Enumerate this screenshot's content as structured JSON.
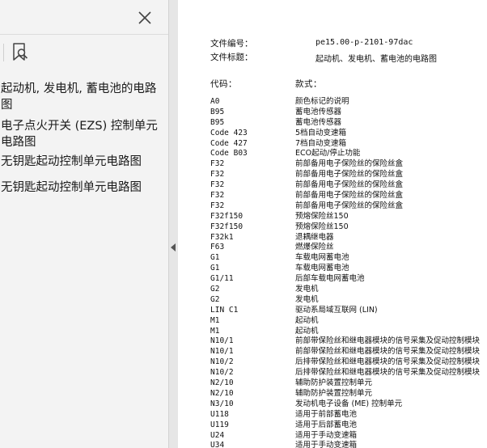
{
  "sidebar": {
    "items": [
      {
        "label": "起动机, 发电机, 蓄电池的电路图"
      },
      {
        "label": "电子点火开关 (EZS) 控制单元电路图"
      },
      {
        "label": "无钥匙起动控制单元电路图"
      },
      {
        "label": "无钥匙起动控制单元电路图"
      }
    ]
  },
  "document": {
    "file_number_label": "文件编号：",
    "file_number_value": "pe15.00-p-2101-97dac",
    "file_title_label": "文件标题：",
    "file_title_value": "起动机、发电机、蓄电池的电路图",
    "code_header": "代码：",
    "desc_header": "款式：",
    "rows": [
      {
        "code": "A0",
        "desc": "颜色标记的说明"
      },
      {
        "code": "B95",
        "desc": "蓄电池传感器"
      },
      {
        "code": "B95",
        "desc": "蓄电池传感器"
      },
      {
        "code": "Code 423",
        "desc": "5档自动变速箱"
      },
      {
        "code": "Code 427",
        "desc": "7档自动变速箱"
      },
      {
        "code": "Code B03",
        "desc": "ECO起动/停止功能"
      },
      {
        "code": "F32",
        "desc": "前部备用电子保险丝的保险丝盒"
      },
      {
        "code": "F32",
        "desc": "前部备用电子保险丝的保险丝盒"
      },
      {
        "code": "F32",
        "desc": "前部备用电子保险丝的保险丝盒"
      },
      {
        "code": "F32",
        "desc": "前部备用电子保险丝的保险丝盒"
      },
      {
        "code": "F32",
        "desc": "前部备用电子保险丝的保险丝盒"
      },
      {
        "code": "F32f150",
        "desc": "预熔保险丝150"
      },
      {
        "code": "F32f150",
        "desc": "预熔保险丝150"
      },
      {
        "code": "F32k1",
        "desc": "退耦继电器"
      },
      {
        "code": "F63",
        "desc": "燃爆保险丝"
      },
      {
        "code": "G1",
        "desc": "车载电网蓄电池"
      },
      {
        "code": "G1",
        "desc": "车载电网蓄电池"
      },
      {
        "code": "G1/11",
        "desc": "后部车载电网蓄电池"
      },
      {
        "code": "G2",
        "desc": "发电机"
      },
      {
        "code": "G2",
        "desc": "发电机"
      },
      {
        "code": "LIN C1",
        "desc": "驱动系局域互联网 (LIN)"
      },
      {
        "code": "M1",
        "desc": "起动机"
      },
      {
        "code": "M1",
        "desc": "起动机"
      },
      {
        "code": "N10/1",
        "desc": "前部带保险丝和继电器模块的信号采集及促动控制模块"
      },
      {
        "code": "N10/1",
        "desc": "前部带保险丝和继电器模块的信号采集及促动控制模块"
      },
      {
        "code": "N10/2",
        "desc": "后排带保险丝和继电器模块的信号采集及促动控制模块"
      },
      {
        "code": "N10/2",
        "desc": "后排带保险丝和继电器模块的信号采集及促动控制模块"
      },
      {
        "code": "N2/10",
        "desc": "辅助防护装置控制单元"
      },
      {
        "code": "N2/10",
        "desc": "辅助防护装置控制单元"
      },
      {
        "code": "N3/10",
        "desc": "发动机电子设备 (ME) 控制单元"
      },
      {
        "code": "U118",
        "desc": "适用于前部蓄电池"
      },
      {
        "code": "U119",
        "desc": "适用于后部蓄电池"
      },
      {
        "code": "U24",
        "desc": "适用于手动变速箱"
      },
      {
        "code": "U34",
        "desc": "适用于手动变速箱"
      }
    ]
  },
  "icons": {
    "close": "close-icon",
    "bookmark": "bookmark-search-icon",
    "collapse": "chevron-left-icon"
  },
  "colors": {
    "sidebar_bg": "#f3f3f3",
    "text": "#111111",
    "light_text": "#a8a8a8"
  }
}
